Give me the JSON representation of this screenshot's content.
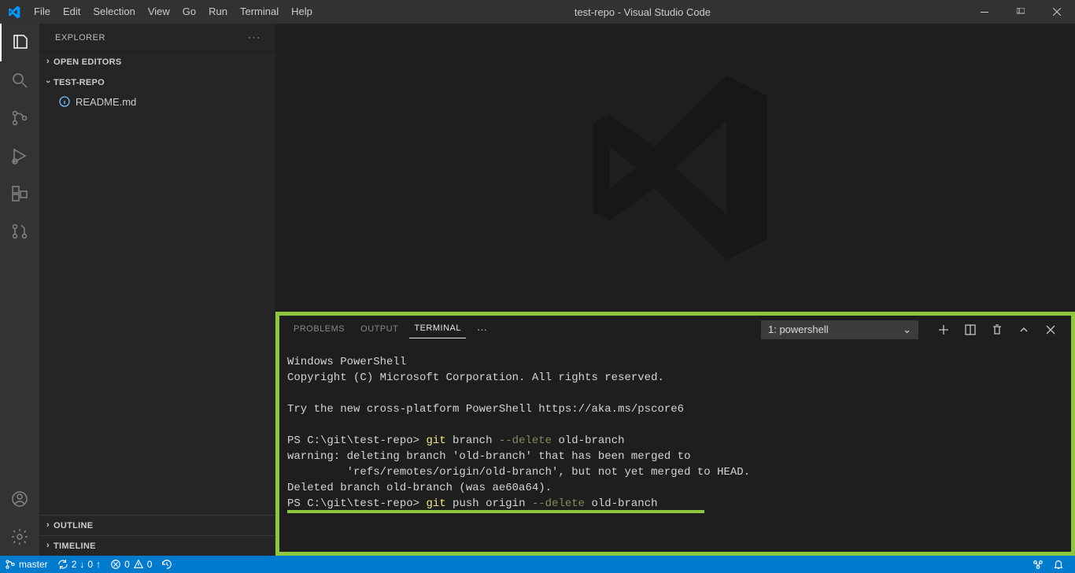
{
  "titlebar": {
    "menus": [
      "File",
      "Edit",
      "Selection",
      "View",
      "Go",
      "Run",
      "Terminal",
      "Help"
    ],
    "title": "test-repo - Visual Studio Code"
  },
  "activitybar": {
    "top": [
      "files-icon",
      "search-icon",
      "source-control-icon",
      "run-debug-icon",
      "extensions-icon",
      "pull-request-icon"
    ],
    "bottom": [
      "account-icon",
      "gear-icon"
    ]
  },
  "sidebar": {
    "title": "EXPLORER",
    "sections": {
      "open_editors": "OPEN EDITORS",
      "repo": "TEST-REPO"
    },
    "files": [
      {
        "icon": "info-icon",
        "name": "README.md"
      }
    ],
    "footer": {
      "outline": "OUTLINE",
      "timeline": "TIMELINE"
    }
  },
  "panel": {
    "tabs": {
      "problems": "PROBLEMS",
      "output": "OUTPUT",
      "terminal": "TERMINAL"
    },
    "active_tab": "terminal",
    "selector": "1: powershell",
    "terminal": {
      "lines": [
        {
          "t": "plain",
          "v": "Windows PowerShell"
        },
        {
          "t": "plain",
          "v": "Copyright (C) Microsoft Corporation. All rights reserved."
        },
        {
          "t": "blank",
          "v": ""
        },
        {
          "t": "plain",
          "v": "Try the new cross-platform PowerShell https://aka.ms/pscore6"
        },
        {
          "t": "blank",
          "v": ""
        },
        {
          "t": "cmd1_prompt",
          "v": "PS C:\\git\\test-repo> "
        },
        {
          "t": "cmd1_git",
          "v": "git"
        },
        {
          "t": "cmd1_arg",
          "v": " branch "
        },
        {
          "t": "cmd1_flag",
          "v": "--delete"
        },
        {
          "t": "cmd1_rest",
          "v": " old-branch"
        },
        {
          "t": "plain",
          "v": "warning: deleting branch 'old-branch' that has been merged to"
        },
        {
          "t": "plain",
          "v": "         'refs/remotes/origin/old-branch', but not yet merged to HEAD."
        },
        {
          "t": "plain",
          "v": "Deleted branch old-branch (was ae60a64)."
        },
        {
          "t": "cmd2_prompt",
          "v": "PS C:\\git\\test-repo> "
        },
        {
          "t": "cmd2_git",
          "v": "git"
        },
        {
          "t": "cmd2_arg",
          "v": " push origin "
        },
        {
          "t": "cmd2_flag",
          "v": "--delete"
        },
        {
          "t": "cmd2_rest",
          "v": " old-branch"
        }
      ]
    }
  },
  "statusbar": {
    "branch": "master",
    "sync_down": "2",
    "sync_up": "0",
    "errors": "0",
    "warnings": "0"
  }
}
